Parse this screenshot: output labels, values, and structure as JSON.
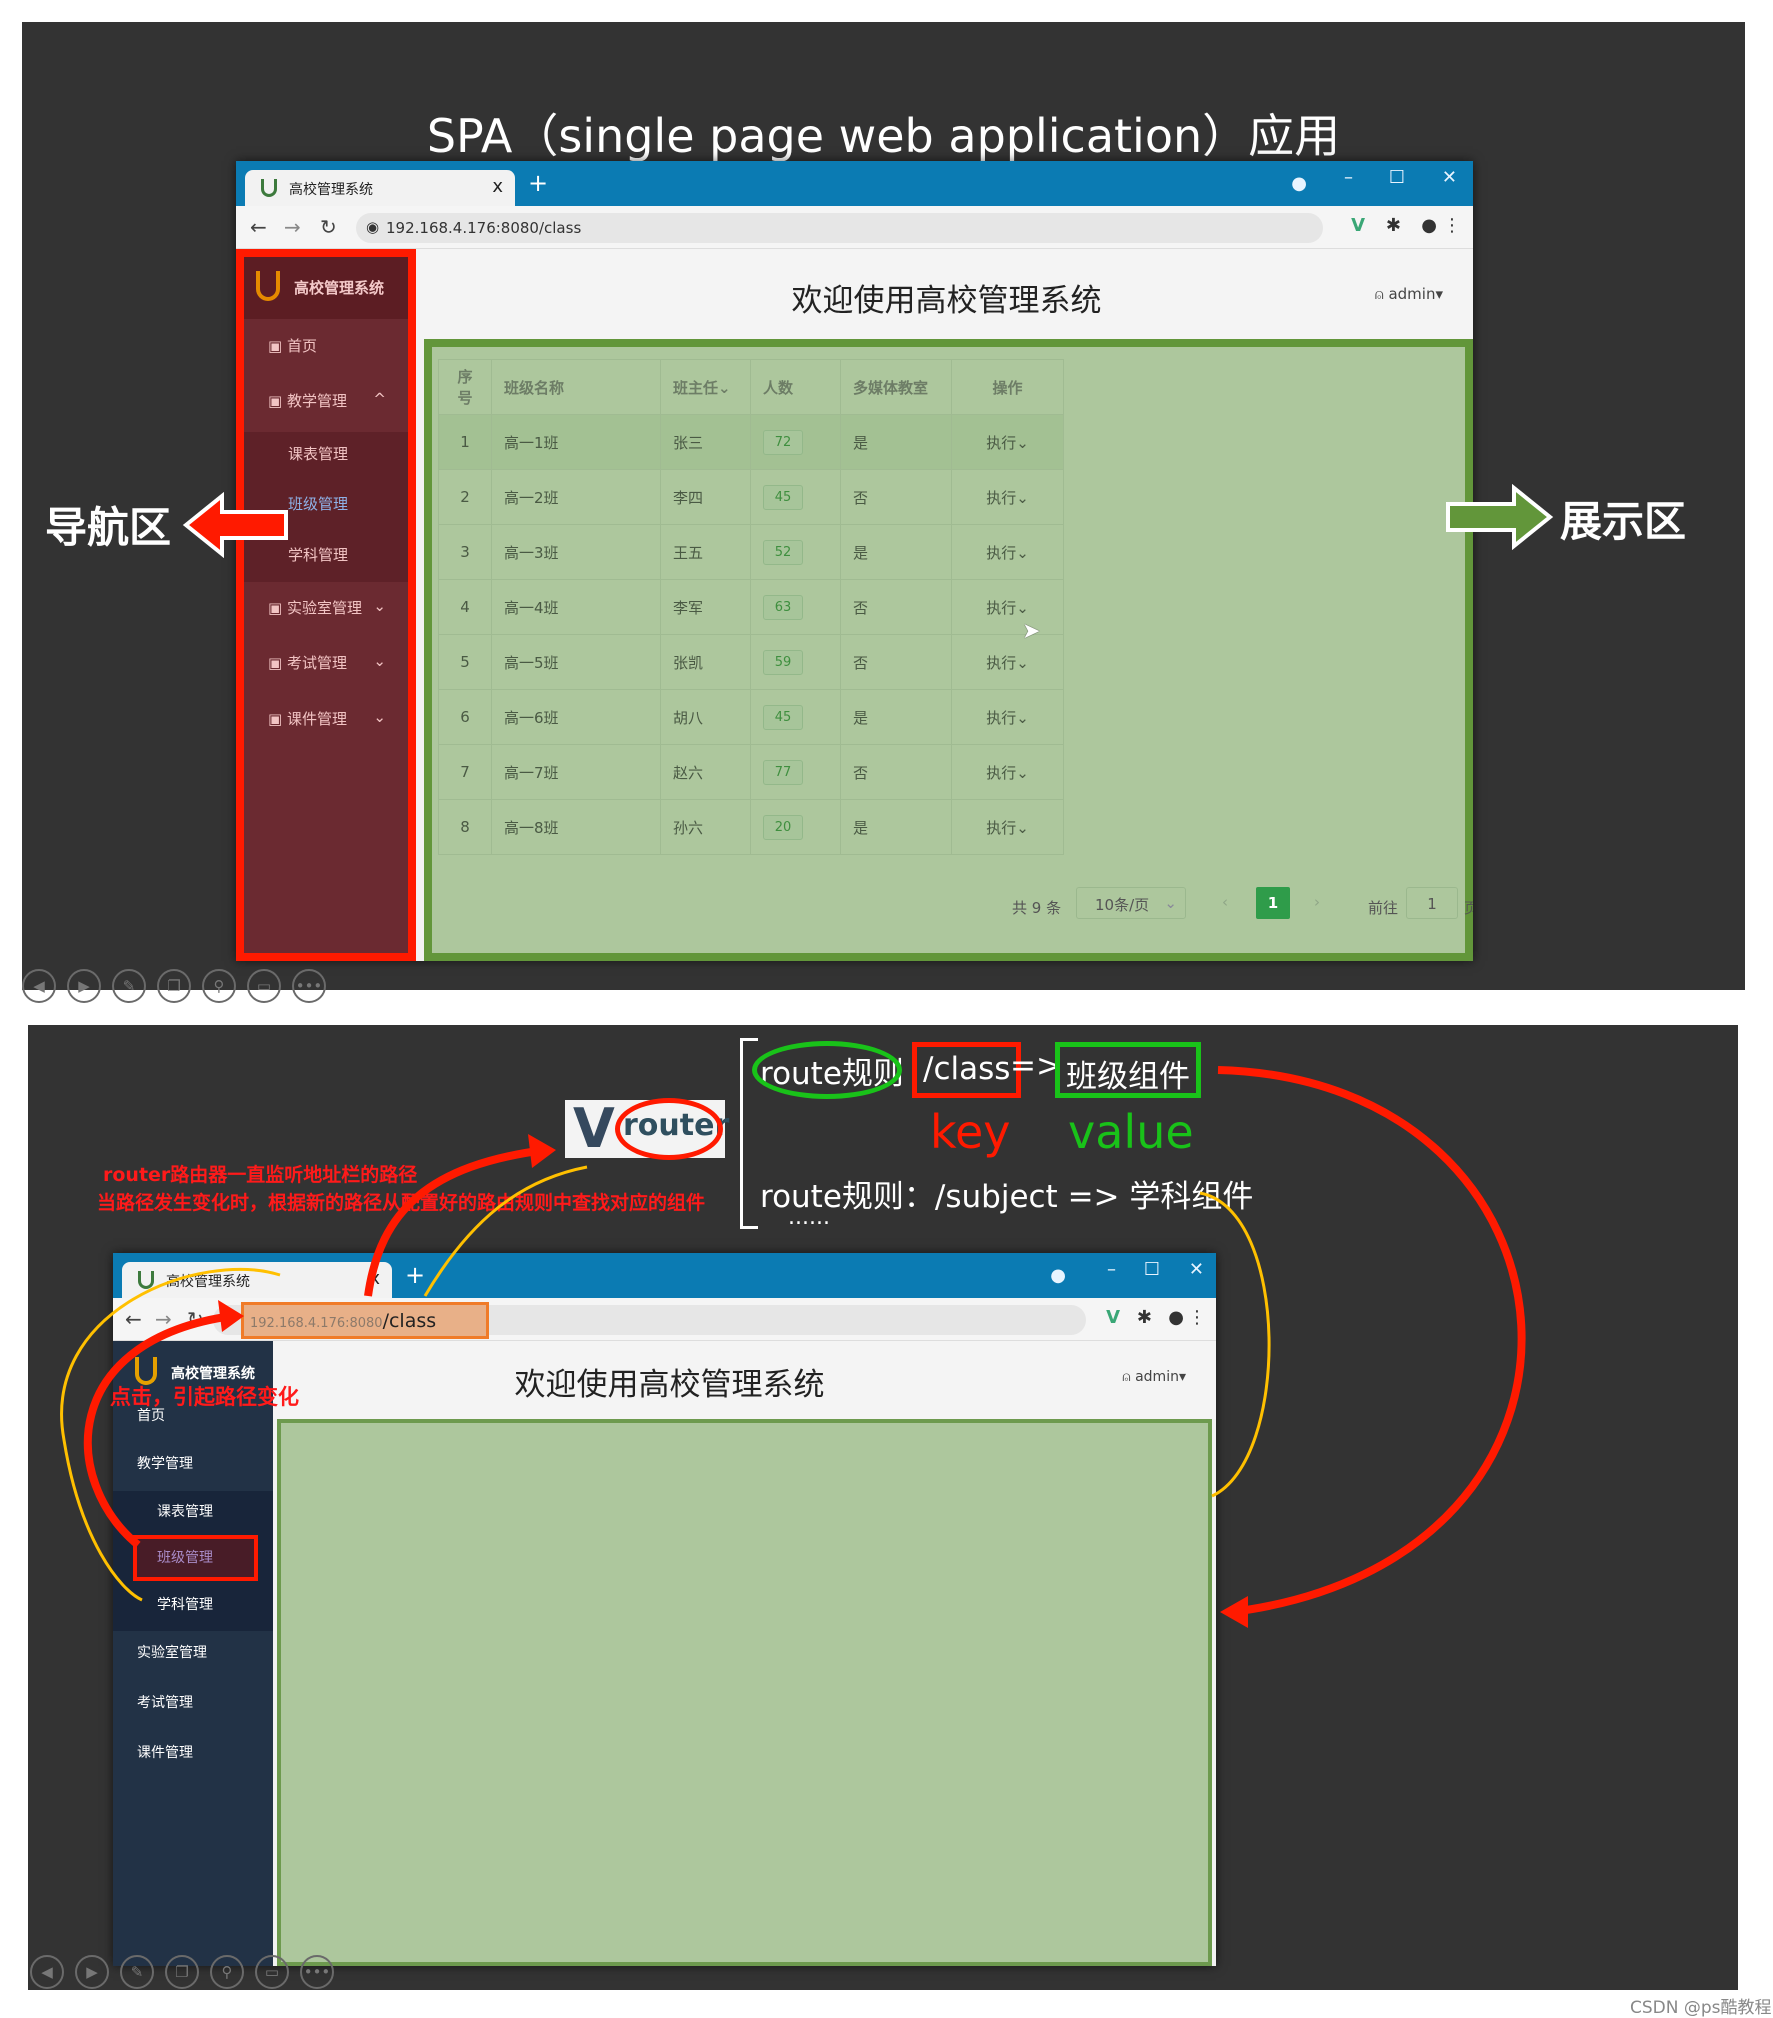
{
  "slide1": {
    "title": "SPA（single page web application）应用",
    "nav_label": "导航区",
    "display_label": "展示区",
    "browser": {
      "tab_title": "高校管理系统",
      "tab_close": "x",
      "new_tab": "+",
      "url": "192.168.4.176:8080/class",
      "page_heading": "欢迎使用高校管理系统",
      "user": "admin▾",
      "sidebar": {
        "brand": "高校管理系统",
        "items": [
          {
            "label": "首页",
            "icon": "dashboard-icon"
          },
          {
            "label": "教学管理",
            "icon": "monitor-icon",
            "chevron": "^"
          },
          {
            "label": "课表管理"
          },
          {
            "label": "班级管理",
            "active": true
          },
          {
            "label": "学科管理"
          },
          {
            "label": "实验室管理",
            "icon": "lab-icon",
            "chevron": "⌄"
          },
          {
            "label": "考试管理",
            "icon": "exam-icon",
            "chevron": "⌄"
          },
          {
            "label": "课件管理",
            "icon": "file-icon",
            "chevron": "⌄"
          }
        ]
      },
      "table": {
        "headers": [
          "序号",
          "班级名称",
          "班主任⌄",
          "人数",
          "多媒体教室",
          "操作"
        ],
        "rows": [
          [
            "1",
            "高一1班",
            "张三",
            "72",
            "是",
            "执行⌄"
          ],
          [
            "2",
            "高一2班",
            "李四",
            "45",
            "否",
            "执行⌄"
          ],
          [
            "3",
            "高一3班",
            "王五",
            "52",
            "是",
            "执行⌄"
          ],
          [
            "4",
            "高一4班",
            "李军",
            "63",
            "否",
            "执行⌄"
          ],
          [
            "5",
            "高一5班",
            "张凯",
            "59",
            "否",
            "执行⌄"
          ],
          [
            "6",
            "高一6班",
            "胡八",
            "45",
            "是",
            "执行⌄"
          ],
          [
            "7",
            "高一7班",
            "赵六",
            "77",
            "否",
            "执行⌄"
          ],
          [
            "8",
            "高一8班",
            "孙六",
            "20",
            "是",
            "执行⌄"
          ]
        ]
      },
      "pagination": {
        "total": "共 9 条",
        "page_size": "10条/页",
        "prev": "‹",
        "current": "1",
        "next": "›",
        "goto_label": "前往",
        "goto_value": "1",
        "page_suffix": "页"
      }
    },
    "colors": {
      "nav_highlight": "#ff1a00",
      "display_highlight": "#62963a",
      "sidebar": "#6b2a31"
    }
  },
  "slide2": {
    "router_logo": "router",
    "rule1": {
      "label": "route规则",
      "key": "/class",
      "arrow": "=>",
      "value": "班级组件"
    },
    "key_label": "key",
    "value_label": "value",
    "rule2": "route规则：/subject => 学科组件",
    "ellipsis": "......",
    "note_line1": "router路由器一直监听地址栏的路径",
    "note_line2": "当路径发生变化时，根据新的路径从配置好的路由规则中查找对应的组件",
    "click_note": "点击，引起路径变化",
    "browser": {
      "tab_title": "高校管理系统",
      "tab_close": "x",
      "new_tab": "+",
      "url_host": "192.168.4.176:8080",
      "url_path": "/class",
      "page_heading": "欢迎使用高校管理系统",
      "user": "admin▾",
      "sidebar": {
        "brand": "高校管理系统",
        "items": [
          {
            "label": "首页"
          },
          {
            "label": "教学管理"
          },
          {
            "label": "课表管理"
          },
          {
            "label": "班级管理"
          },
          {
            "label": "学科管理"
          },
          {
            "label": "实验室管理"
          },
          {
            "label": "考试管理"
          },
          {
            "label": "课件管理"
          }
        ]
      }
    }
  },
  "player_controls": [
    "prev-icon",
    "next-icon",
    "pen-icon",
    "slides-icon",
    "zoom-icon",
    "subtitle-icon",
    "more-icon"
  ],
  "watermark": "CSDN @ps酷教程"
}
